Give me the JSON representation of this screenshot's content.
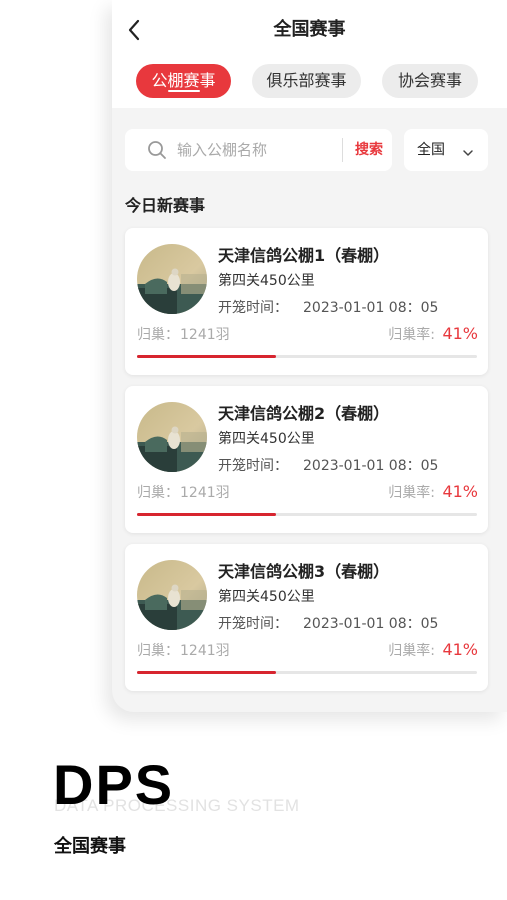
{
  "header": {
    "title": "全国赛事",
    "back_icon": "chevron-left-icon"
  },
  "tabs": [
    {
      "label": "公棚赛事",
      "active": true
    },
    {
      "label": "俱乐部赛事",
      "active": false
    },
    {
      "label": "协会赛事",
      "active": false
    }
  ],
  "search": {
    "placeholder": "输入公棚名称",
    "button_label": "搜索",
    "icon": "search-icon"
  },
  "region_filter": {
    "selected": "全国",
    "icon": "chevron-down-icon"
  },
  "section": {
    "title": "今日新赛事"
  },
  "races": [
    {
      "name": "天津信鸽公棚1（春棚）",
      "route": "第四关450公里",
      "time_label": "开笼时间：",
      "time": "2023-01-01 08：05",
      "return_label": "归巢：",
      "return_count": "1241羽",
      "rate_label": "归巢率:",
      "rate_value": "41%",
      "rate_fraction": 0.41
    },
    {
      "name": "天津信鸽公棚2（春棚）",
      "route": "第四关450公里",
      "time_label": "开笼时间：",
      "time": "2023-01-01 08：05",
      "return_label": "归巢：",
      "return_count": "1241羽",
      "rate_label": "归巢率:",
      "rate_value": "41%",
      "rate_fraction": 0.41
    },
    {
      "name": "天津信鸽公棚3（春棚）",
      "route": "第四关450公里",
      "time_label": "开笼时间：",
      "time": "2023-01-01 08：05",
      "return_label": "归巢：",
      "return_count": "1241羽",
      "rate_label": "归巢率:",
      "rate_value": "41%",
      "rate_fraction": 0.41
    }
  ],
  "brand": {
    "logo": "DPS",
    "tagline": "DATA PROCESSING SYSTEM",
    "caption": "全国赛事"
  },
  "colors": {
    "accent": "#e8383d",
    "progress": "#d7252f",
    "background": "#f4f4f4"
  }
}
